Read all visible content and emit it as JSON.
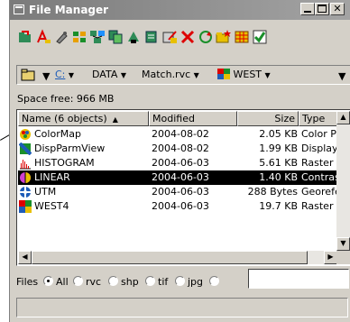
{
  "window": {
    "title": "File Manager"
  },
  "toolbar": {
    "buttons": [
      "open-folder",
      "highlighter",
      "pin",
      "tools",
      "network",
      "copy",
      "delete-user",
      "print",
      "edit",
      "delete",
      "refresh",
      "new-folder",
      "grid",
      "check"
    ]
  },
  "address": {
    "drive": "C:",
    "path": [
      "DATA",
      "Match.rvc",
      "WEST"
    ]
  },
  "space_free": "Space free: 966 MB",
  "columns": {
    "name": "Name (6 objects)",
    "modified": "Modified",
    "size": "Size",
    "type": "Type"
  },
  "files": [
    {
      "name": "ColorMap",
      "modified": "2004-08-02",
      "size": "2.05 KB",
      "type": "Color Pal",
      "icon": "colormap-icon"
    },
    {
      "name": "DispParmView",
      "modified": "2004-08-02",
      "size": "1.99 KB",
      "type": "Display P",
      "icon": "display-params-icon"
    },
    {
      "name": "HISTOGRAM",
      "modified": "2004-06-03",
      "size": "5.61 KB",
      "type": "Raster H",
      "icon": "histogram-icon"
    },
    {
      "name": "LINEAR",
      "modified": "2004-06-03",
      "size": "1.40 KB",
      "type": "Contrast",
      "icon": "contrast-icon"
    },
    {
      "name": "UTM",
      "modified": "2004-06-03",
      "size": "288 Bytes",
      "type": "Georefer",
      "icon": "georeference-icon"
    },
    {
      "name": "WEST4",
      "modified": "2004-06-03",
      "size": "19.7 KB",
      "type": "Raster",
      "icon": "raster-icon"
    }
  ],
  "selected_index": 3,
  "filters": {
    "label": "Files",
    "options": [
      "All",
      "rvc",
      "shp",
      "tif",
      "jpg",
      ""
    ],
    "selected": "All"
  },
  "colors": {
    "selection": "#000000",
    "face": "#d4d0c8",
    "title": "#8c8c8c"
  }
}
